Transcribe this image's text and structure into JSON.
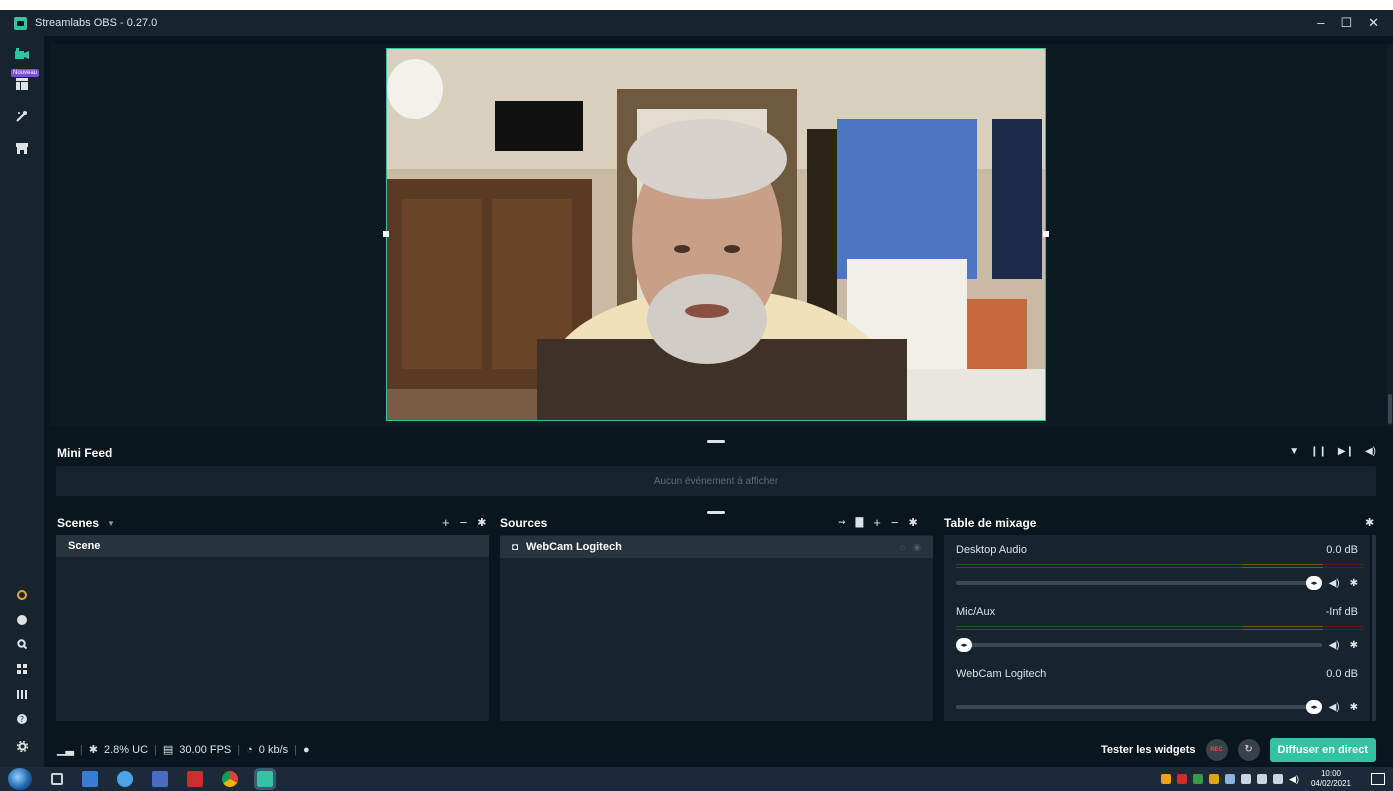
{
  "window": {
    "title": "Streamlabs OBS - 0.27.0",
    "minimize": "–",
    "maximize": "☐",
    "close": "✕"
  },
  "nav": {
    "new_badge": "Nouveau"
  },
  "mini_feed": {
    "title": "Mini Feed",
    "empty_text": "Aucun événement à afficher"
  },
  "scenes": {
    "title": "Scenes",
    "items": [
      "Scene"
    ]
  },
  "sources": {
    "title": "Sources",
    "items": [
      "WebCam Logitech"
    ]
  },
  "mixer": {
    "title": "Table de mixage",
    "channels": [
      {
        "name": "Desktop Audio",
        "level": "0.0 dB",
        "volume": 1.0
      },
      {
        "name": "Mic/Aux",
        "level": "-Inf dB",
        "volume": 0.0
      },
      {
        "name": "WebCam Logitech",
        "level": "0.0 dB",
        "volume": 1.0
      }
    ]
  },
  "footer": {
    "cpu": "2.8% UC",
    "fps": "30.00 FPS",
    "bitrate": "0 kb/s",
    "test_widgets": "Tester les widgets",
    "rec_label": "REC",
    "go_live": "Diffuser en direct"
  },
  "taskbar": {
    "time": "10:00",
    "date": "04/02/2021"
  },
  "colors": {
    "accent": "#31c3a2",
    "bg": "#09161d",
    "panel": "#17242d"
  }
}
